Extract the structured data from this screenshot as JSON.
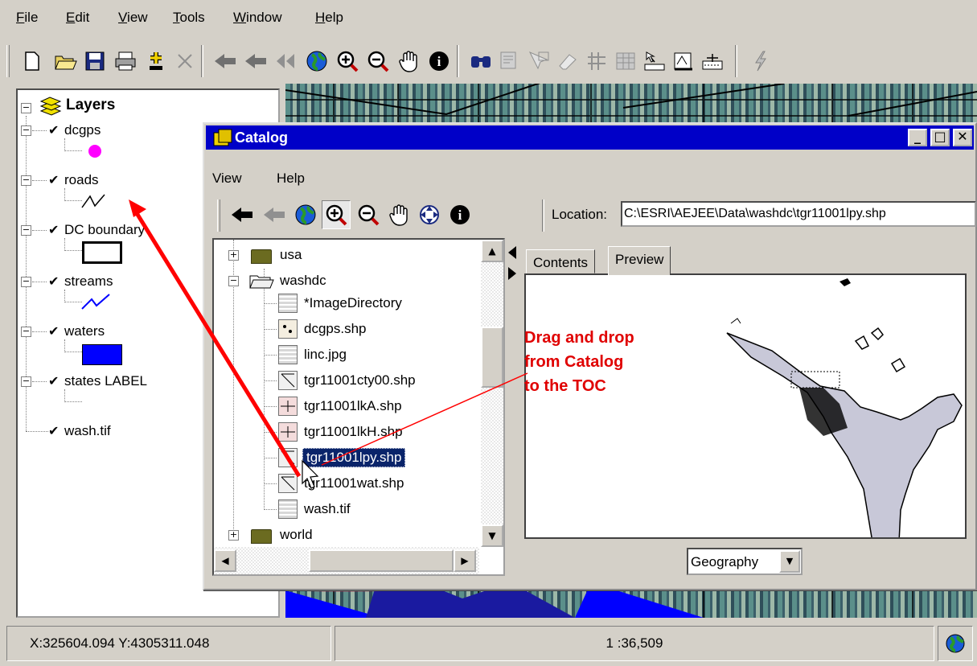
{
  "menu": [
    "File",
    "Edit",
    "View",
    "Tools",
    "Window",
    "Help"
  ],
  "toolbar_icons": [
    "new-icon",
    "open-icon",
    "save-icon",
    "print-icon",
    "add-data-icon",
    "delete-icon",
    "back-extent-icon",
    "forward-extent-icon",
    "full-extent-icon",
    "globe-icon",
    "zoom-in-icon",
    "zoom-out-icon",
    "pan-icon",
    "identify-icon",
    "find-icon",
    "query-icon",
    "select-icon",
    "erase-icon",
    "measure-icon",
    "table-icon",
    "hotlink-icon",
    "label-icon",
    "edit-icon",
    "lightning-icon"
  ],
  "toc": {
    "title": "Layers",
    "layers": [
      {
        "name": "dcgps",
        "checked": true,
        "symbol": "magenta-point"
      },
      {
        "name": "roads",
        "checked": true,
        "symbol": "line"
      },
      {
        "name": "DC boundary",
        "checked": true,
        "symbol": "polygon-outline"
      },
      {
        "name": "streams",
        "checked": true,
        "symbol": "blue-line"
      },
      {
        "name": "waters",
        "checked": true,
        "symbol": "blue-fill"
      },
      {
        "name": "states LABEL",
        "checked": true,
        "symbol": "none"
      },
      {
        "name": "wash.tif",
        "checked": true,
        "symbol": "none"
      }
    ]
  },
  "status": {
    "coords": "X:325604.094 Y:4305311.048",
    "scale": "1 :36,509"
  },
  "catalog": {
    "title": "Catalog",
    "menu": [
      "View",
      "Help"
    ],
    "location_label": "Location:",
    "location_value": "C:\\ESRI\\AEJEE\\Data\\washdc\\tgr11001lpy.shp",
    "tree": [
      {
        "label": "usa",
        "type": "folder",
        "expand": "+"
      },
      {
        "label": "washdc",
        "type": "folder-open",
        "expand": "-"
      },
      {
        "label": "*ImageDirectory",
        "type": "image"
      },
      {
        "label": "dcgps.shp",
        "type": "point"
      },
      {
        "label": "linc.jpg",
        "type": "image"
      },
      {
        "label": "tgr11001cty00.shp",
        "type": "polygon"
      },
      {
        "label": "tgr11001lkA.shp",
        "type": "line"
      },
      {
        "label": "tgr11001lkH.shp",
        "type": "line"
      },
      {
        "label": "tgr11001lpy.shp",
        "type": "polygon",
        "selected": true
      },
      {
        "label": "tgr11001wat.shp",
        "type": "polygon"
      },
      {
        "label": "wash.tif",
        "type": "image"
      },
      {
        "label": "world",
        "type": "folder",
        "expand": "+"
      }
    ],
    "tabs": [
      "Contents",
      "Preview"
    ],
    "active_tab": "Preview",
    "preview_mode": "Geography"
  },
  "annotation": [
    "Drag and drop",
    "from Catalog",
    "to the TOC"
  ],
  "colors": {
    "catalog_title": "#0000C8",
    "selection": "#0A246A",
    "annotation": "#E00000",
    "dcgps_point": "#FF00FF",
    "waters_fill": "#0000FF"
  }
}
